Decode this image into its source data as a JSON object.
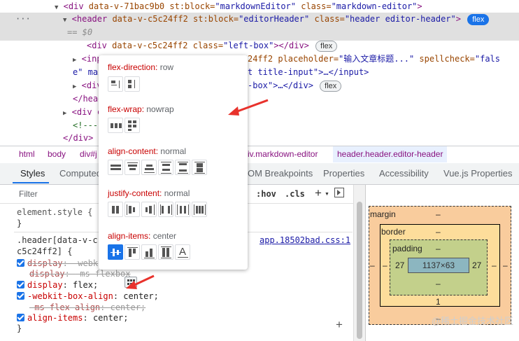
{
  "dom": {
    "lines": [
      {
        "pre": "▼",
        "open": "<div ",
        "a1": "data-v-71bac9b0",
        "a2": " st:block=",
        "v2": "\"markdownEditor\"",
        "a3": " class=",
        "v3": "\"markdown-editor\"",
        "close": ">"
      },
      {
        "pre": "▼",
        "open": "<header ",
        "a1": "data-v-c5c24ff2",
        "a2": " st:block=",
        "v2": "\"editorHeader\"",
        "a3": " class=",
        "v3": "\"header editor-header\"",
        "close": ">"
      },
      {
        "eq": "== $0"
      },
      {
        "open": "<div ",
        "a1": "data-v-c5c24ff2",
        "a3": " class=",
        "v3": "\"left-box\"",
        "close": "></div>"
      },
      {
        "pre": "▶",
        "open": "<inp",
        "tail": "24ff2 placeholder=",
        "v": "\"输入文章标题...\"",
        "tail2": " spellcheck=",
        "v2": "\"fals"
      },
      {
        "cont": "e\" max",
        "tail": "t title-input\">…</input>"
      },
      {
        "pre": "▶",
        "open": "<div",
        "tail": "-box\">…</div>"
      },
      {
        "close": "</head"
      },
      {
        "pre": "▶",
        "open": "<div c"
      },
      {
        "comment": "<!---"
      },
      {
        "close": "</div>"
      }
    ],
    "dots": "···",
    "flex_badge": "flex"
  },
  "breadcrumbs": [
    "html",
    "body",
    "div#j",
    "iv.markdown-editor",
    "header.header.editor-header"
  ],
  "tabs": [
    "Styles",
    "Computed",
    "OM Breakpoints",
    "Properties",
    "Accessibility",
    "Vue.js Properties"
  ],
  "filter": {
    "placeholder": "Filter",
    "hov": ":hov",
    "cls": ".cls",
    "plus": "+"
  },
  "styles": {
    "element_style": "element.style {",
    "close_brace": "}",
    "rule_selector_1": ".header[data-v-c",
    "rule_selector_2": "c5c24ff2] {",
    "source": "app.18502bad.css:1",
    "decls": [
      {
        "prop": "display",
        "val": "-webk",
        "checked": true,
        "struck": true
      },
      {
        "prop": "display",
        "val": "-ms-flexbox",
        "checked": false,
        "struck": true
      },
      {
        "prop": "display",
        "val": "flex",
        "checked": true,
        "struck": false
      },
      {
        "prop": "-webkit-box-align",
        "val": "center",
        "checked": true,
        "struck": false
      },
      {
        "prop": "-ms-flex-align",
        "val": "center",
        "checked": false,
        "struck": true
      },
      {
        "prop": "align-items",
        "val": "center",
        "checked": true,
        "struck": false
      }
    ],
    "plus": "+"
  },
  "popover": {
    "flex_direction": {
      "label": "flex-direction",
      "value": "row"
    },
    "flex_wrap": {
      "label": "flex-wrap",
      "value": "nowrap"
    },
    "align_content": {
      "label": "align-content",
      "value": "normal"
    },
    "justify_content": {
      "label": "justify-content",
      "value": "normal"
    },
    "align_items": {
      "label": "align-items",
      "value": "center"
    }
  },
  "box_model": {
    "margin": "margin",
    "border": "border",
    "padding": "padding",
    "dash": "–",
    "content": "1137×63",
    "pad_left": "27",
    "pad_right": "27",
    "one": "1"
  },
  "watermark": "@稀土掘金技术社区",
  "colors": {
    "accent": "#1a73e8",
    "arrow": "#e8322c"
  }
}
